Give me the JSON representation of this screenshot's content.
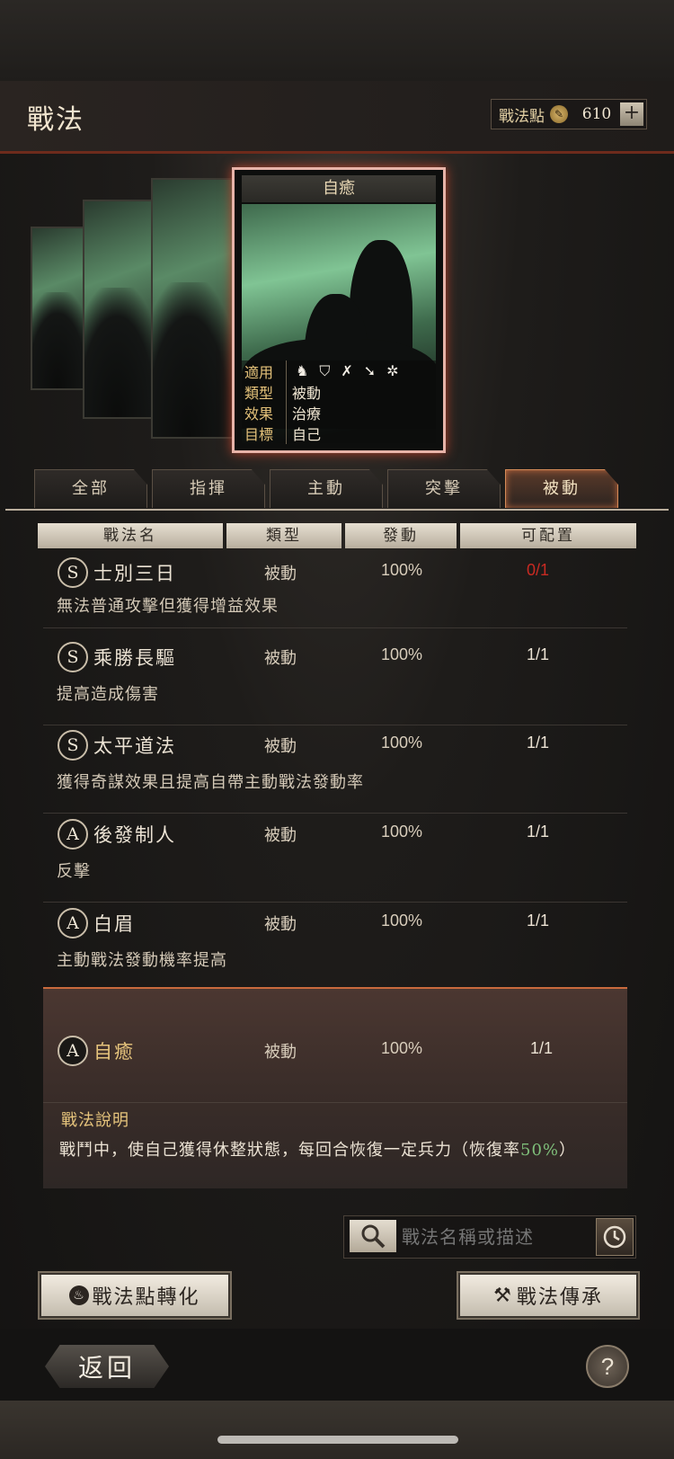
{
  "header": {
    "title": "戰法",
    "points_label": "戰法點",
    "points_value": "610",
    "plus_label": "+"
  },
  "card": {
    "name": "自癒",
    "rows": [
      {
        "key": "適用",
        "value": ""
      },
      {
        "key": "類型",
        "value": "被動"
      },
      {
        "key": "效果",
        "value": "治療"
      },
      {
        "key": "目標",
        "value": "自己"
      }
    ],
    "unit_icons": [
      "cavalry-icon",
      "shield-icon",
      "bow-icon",
      "spear-icon",
      "wheel-icon"
    ]
  },
  "tabs": [
    {
      "label": "全部",
      "active": false
    },
    {
      "label": "指揮",
      "active": false
    },
    {
      "label": "主動",
      "active": false
    },
    {
      "label": "突擊",
      "active": false
    },
    {
      "label": "被動",
      "active": true
    }
  ],
  "columns": [
    "戰法名",
    "類型",
    "發動",
    "可配置"
  ],
  "items": [
    {
      "grade": "S",
      "name": "士別三日",
      "type": "被動",
      "rate": "100%",
      "config": "0/1",
      "desc": "無法普通攻擊但獲得增益效果"
    },
    {
      "grade": "S",
      "name": "乘勝長驅",
      "type": "被動",
      "rate": "100%",
      "config": "1/1",
      "desc": "提高造成傷害"
    },
    {
      "grade": "S",
      "name": "太平道法",
      "type": "被動",
      "rate": "100%",
      "config": "1/1",
      "desc": "獲得奇謀效果且提高自帶主動戰法發動率"
    },
    {
      "grade": "A",
      "name": "後發制人",
      "type": "被動",
      "rate": "100%",
      "config": "1/1",
      "desc": "反擊"
    },
    {
      "grade": "A",
      "name": "白眉",
      "type": "被動",
      "rate": "100%",
      "config": "1/1",
      "desc": "主動戰法發動機率提高"
    }
  ],
  "selected": {
    "grade": "A",
    "name": "自癒",
    "type": "被動",
    "rate": "100%",
    "config": "1/1",
    "desc_title": "戰法說明",
    "desc_text": "戰鬥中，使自己獲得休整狀態，每回合恢復一定兵力（恢復率",
    "desc_pct": "50%",
    "desc_end": "）"
  },
  "search": {
    "placeholder": "戰法名稱或描述"
  },
  "buttons": {
    "convert": "戰法點轉化",
    "inherit": "戰法傳承"
  },
  "footer": {
    "back": "返回",
    "help": "?"
  }
}
